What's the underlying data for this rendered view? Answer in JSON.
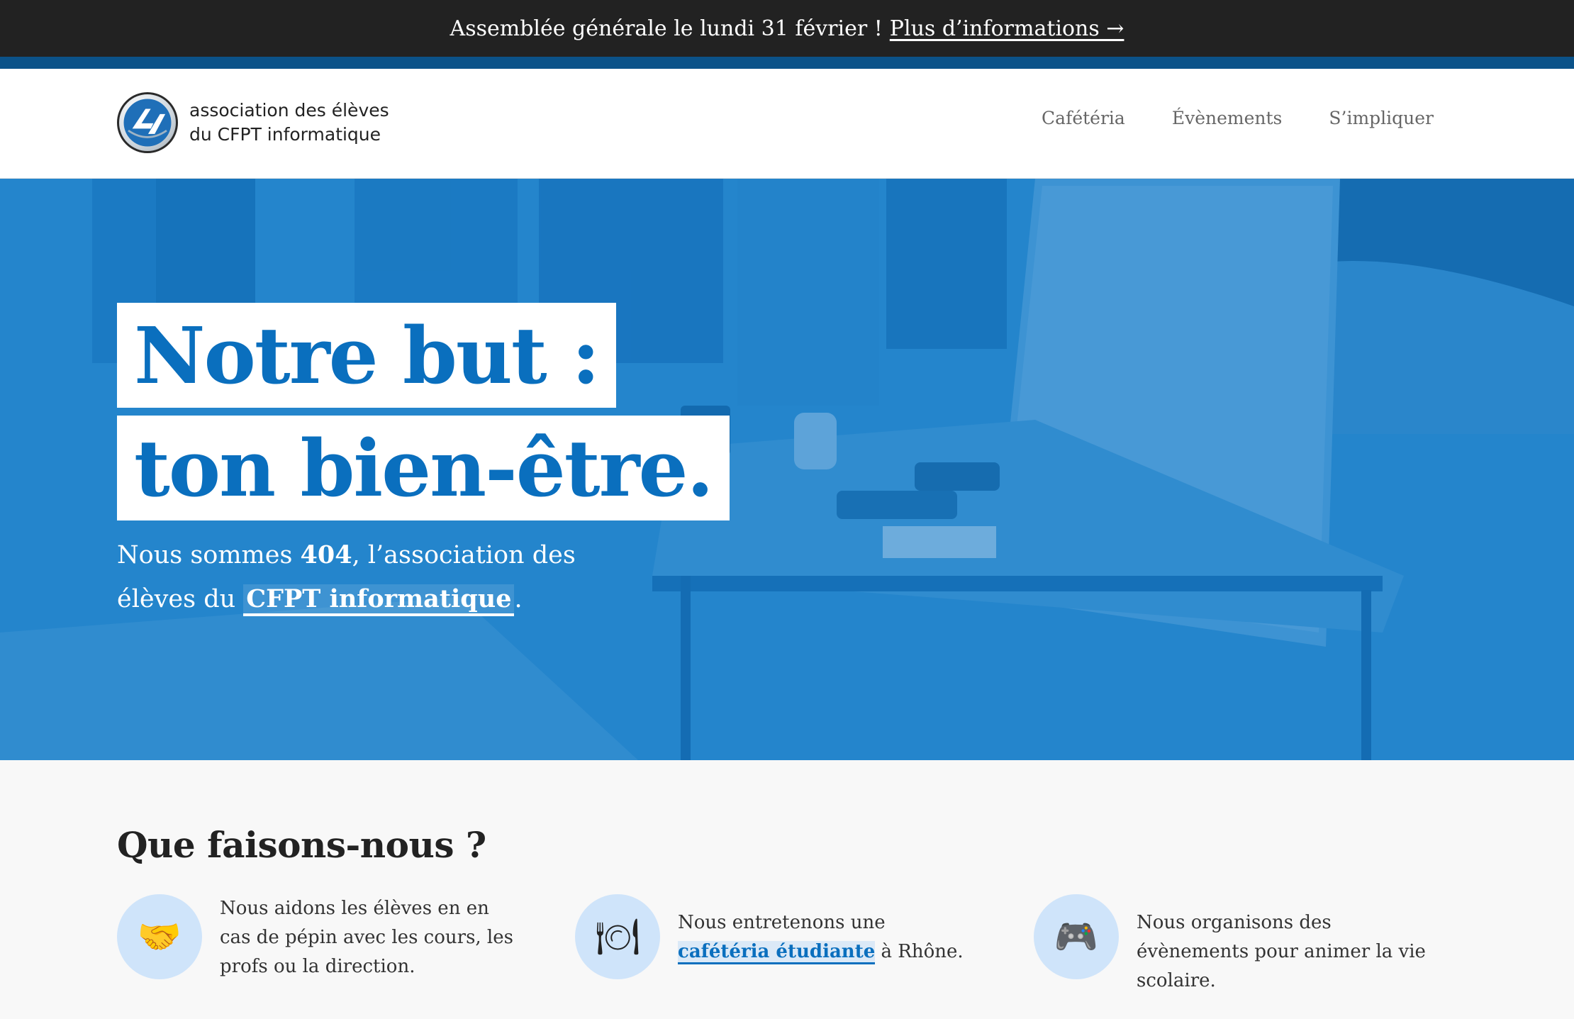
{
  "announcement": {
    "text": "Assemblée générale le lundi 31 février !",
    "link_label": "Plus d’informations →"
  },
  "header": {
    "brand_line1": "association des élèves",
    "brand_line2": "du CFPT informatique",
    "nav": [
      {
        "label": "Cafétéria"
      },
      {
        "label": "Évènements"
      },
      {
        "label": "S’impliquer"
      }
    ]
  },
  "hero": {
    "headline_line1": "Notre but :",
    "headline_line2": "ton bien-être.",
    "sub_prefix": "Nous sommes ",
    "sub_bold": "404",
    "sub_middle": ", l’association des élèves du ",
    "sub_link": "CFPT informatique",
    "sub_suffix": "."
  },
  "section": {
    "title": "Que faisons-nous ?",
    "features": [
      {
        "icon": "handshake-icon",
        "glyph": "🤝",
        "text": "Nous aidons les élèves en en cas de pépin avec les cours, les profs ou la direction."
      },
      {
        "icon": "plate-cutlery-icon",
        "glyph": "🍽",
        "text_prefix": "Nous entretenons une ",
        "link": "cafétéria étudiante",
        "text_suffix": " à Rhône."
      },
      {
        "icon": "gamepad-icon",
        "glyph": "🎮",
        "text": "Nous organisons des évènements pour animer la vie scolaire."
      }
    ]
  },
  "colors": {
    "accent": "#0a6fbe",
    "announce_bg": "#222222",
    "stripe": "#0b5289",
    "icon_circle": "#cfe4fa"
  }
}
